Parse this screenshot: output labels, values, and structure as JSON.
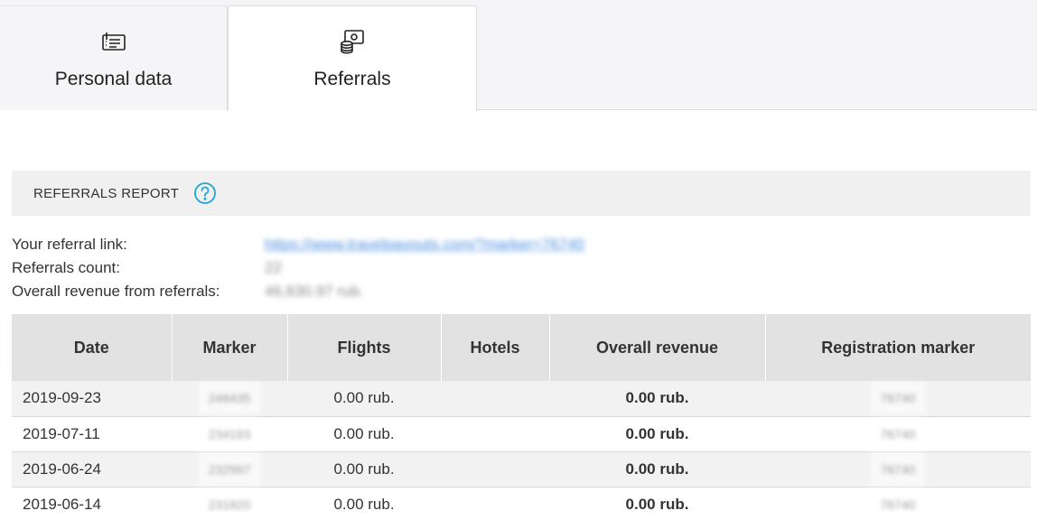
{
  "tabs": [
    {
      "label": "Personal data",
      "icon": "id-card-icon",
      "active": false
    },
    {
      "label": "Referrals",
      "icon": "referrals-coins-icon",
      "active": true
    }
  ],
  "report": {
    "title": "REFERRALS REPORT",
    "help_icon": "question-circle-icon",
    "help_color": "#1aa7d6"
  },
  "info": {
    "link_label": "Your referral link:",
    "link_value": "https://www.travelpayouts.com/?marker=76740",
    "count_label": "Referrals count:",
    "count_value": "22",
    "revenue_label": "Overall revenue from referrals:",
    "revenue_value": "46,830.97 rub."
  },
  "table": {
    "headers": [
      "Date",
      "Marker",
      "Flights",
      "Hotels",
      "Overall revenue",
      "Registration marker"
    ],
    "rows": [
      {
        "date": "2019-09-23",
        "marker": "248435",
        "flights": "0.00 rub.",
        "hotels": "",
        "revenue": "0.00 rub.",
        "reg_marker": "76740"
      },
      {
        "date": "2019-07-11",
        "marker": "234193",
        "flights": "0.00 rub.",
        "hotels": "",
        "revenue": "0.00 rub.",
        "reg_marker": "76740"
      },
      {
        "date": "2019-06-24",
        "marker": "232997",
        "flights": "0.00 rub.",
        "hotels": "",
        "revenue": "0.00 rub.",
        "reg_marker": "76740"
      },
      {
        "date": "2019-06-14",
        "marker": "231820",
        "flights": "0.00 rub.",
        "hotels": "",
        "revenue": "0.00 rub.",
        "reg_marker": "76740"
      }
    ]
  }
}
